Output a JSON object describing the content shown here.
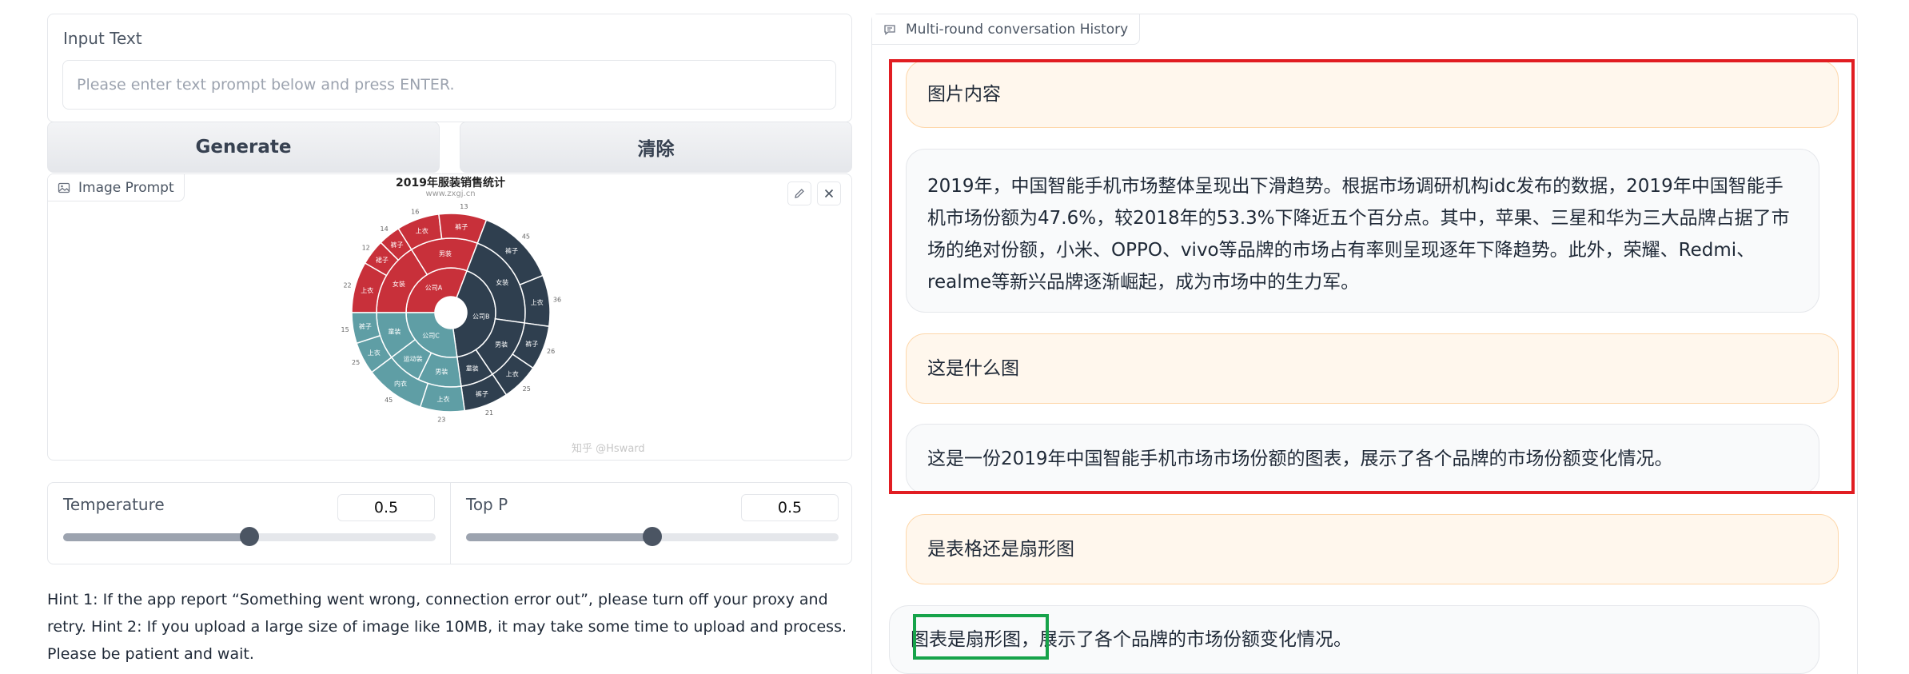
{
  "input": {
    "label": "Input Text",
    "placeholder": "Please enter text prompt below and press ENTER."
  },
  "buttons": {
    "generate": "Generate",
    "clear": "清除"
  },
  "image_prompt": {
    "label": "Image Prompt",
    "edit_icon": "pencil-icon",
    "close_icon": "close-icon",
    "chart_title": "2019年服装销售统计",
    "chart_subtitle": "www.zxgj.cn",
    "watermark": "知乎 @Hsward"
  },
  "chart_data": {
    "type": "sunburst",
    "title": "2019年服装销售统计",
    "inner": [
      {
        "name": "公司A",
        "color": "#c8303a"
      },
      {
        "name": "公司B",
        "color": "#2f3f4f"
      },
      {
        "name": "公司C",
        "color": "#5f9ea5"
      }
    ],
    "middle": [
      {
        "name": "女装",
        "parent": "公司A"
      },
      {
        "name": "男装",
        "parent": "公司A"
      },
      {
        "name": "女装",
        "parent": "公司B"
      },
      {
        "name": "男装",
        "parent": "公司B"
      },
      {
        "name": "童装",
        "parent": "公司B"
      },
      {
        "name": "男装",
        "parent": "公司C"
      },
      {
        "name": "运动装",
        "parent": "公司C"
      },
      {
        "name": "童装",
        "parent": "公司C"
      }
    ],
    "outer": [
      {
        "name": "上衣",
        "value": 22
      },
      {
        "name": "裙子",
        "value": 12
      },
      {
        "name": "裤子",
        "value": 14
      },
      {
        "name": "上衣",
        "value": 16
      },
      {
        "name": "裤子",
        "value": 13
      },
      {
        "name": "裤子",
        "value": 45
      },
      {
        "name": "上衣",
        "value": 36
      },
      {
        "name": "裤子",
        "value": 26
      },
      {
        "name": "上衣",
        "value": 25
      },
      {
        "name": "裤子",
        "value": 21
      },
      {
        "name": "上衣",
        "value": 23
      },
      {
        "name": "内衣",
        "value": 45
      },
      {
        "name": "上衣",
        "value": 25
      },
      {
        "name": "裤子",
        "value": 15
      }
    ]
  },
  "params": {
    "temperature": {
      "label": "Temperature",
      "value": "0.5",
      "fraction": 0.5
    },
    "top_p": {
      "label": "Top P",
      "value": "0.5",
      "fraction": 0.5
    }
  },
  "hint": "Hint 1: If the app report “Something went wrong, connection error out”, please turn off your proxy and retry. Hint 2: If you upload a large size of image like 10MB, it may take some time to upload and process. Please be patient and wait.",
  "chat": {
    "label": "Multi-round conversation History",
    "messages": [
      {
        "role": "user",
        "text": "图片内容"
      },
      {
        "role": "bot",
        "text": "2019年，中国智能手机市场整体呈现出下滑趋势。根据市场调研机构idc发布的数据，2019年中国智能手机市场份额为47.6%，较2018年的53.3%下降近五个百分点。其中，苹果、三星和华为三大品牌占据了市场的绝对份额，小米、OPPO、vivo等品牌的市场占有率则呈现逐年下降趋势。此外，荣耀、Redmi、realme等新兴品牌逐渐崛起，成为市场中的生力军。"
      },
      {
        "role": "user",
        "text": "这是什么图"
      },
      {
        "role": "bot",
        "text": "这是一份2019年中国智能手机市场市场份额的图表，展示了各个品牌的市场份额变化情况。"
      },
      {
        "role": "user",
        "text": "是表格还是扇形图"
      },
      {
        "role": "bot",
        "text": "图表是扇形图，展示了各个品牌的市场份额变化情况。"
      }
    ]
  }
}
